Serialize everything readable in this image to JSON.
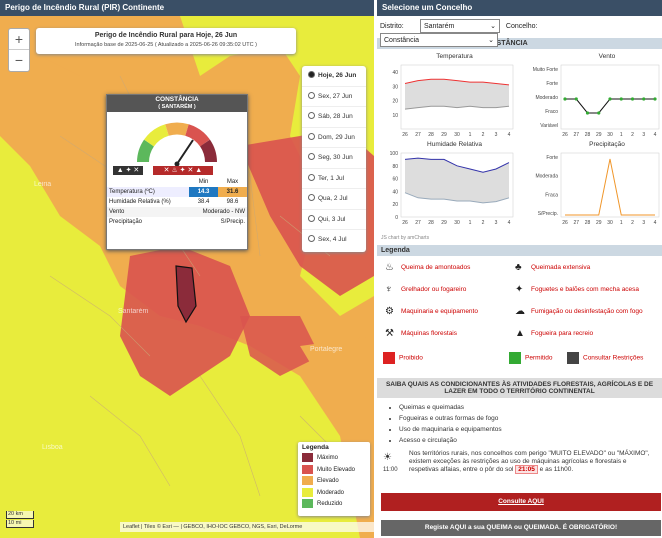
{
  "map": {
    "header": "Perigo de Incêndio Rural (PIR) Continente",
    "title": "Perigo de Incêndio Rural para Hoje, 26 Jun",
    "subtitle": "Informação base de 2025-06-25 ( Atualizado a 2025-06-26 09:35:02 UTC )",
    "zoom_in": "+",
    "zoom_out": "−",
    "days": [
      "Hoje, 26 Jun",
      "Sex, 27 Jun",
      "Sáb, 28 Jun",
      "Dom, 29 Jun",
      "Seg, 30 Jun",
      "Ter, 1 Jul",
      "Qua, 2 Jul",
      "Qui, 3 Jul",
      "Sex, 4 Jul"
    ],
    "places": [
      "Leiria",
      "Santarém",
      "Portalegre",
      "Lisboa"
    ],
    "popup": {
      "title": "CONSTÂNCIA",
      "sub": "( SANTARÉM )",
      "min_label": "Min",
      "max_label": "Max",
      "rows": [
        {
          "label": "Temperatura (ºC)",
          "min": "14.3",
          "max": "31.6"
        },
        {
          "label": "Humidade Relativa (%)",
          "min": "38.4",
          "max": "98.6"
        }
      ],
      "wind_label": "Vento",
      "wind": "Moderado - NW",
      "precip_label": "Precipitação",
      "precip": "S/Precip."
    },
    "legend": {
      "title": "Legenda",
      "items": [
        {
          "label": "Máximo",
          "color": "#8b2b3a"
        },
        {
          "label": "Muito Elevado",
          "color": "#d9534f"
        },
        {
          "label": "Elevado",
          "color": "#f0ad4e"
        },
        {
          "label": "Moderado",
          "color": "#e8ec3c"
        },
        {
          "label": "Reduzido",
          "color": "#5cb85c"
        }
      ]
    },
    "scale": [
      "20 km",
      "10 mi"
    ],
    "attribution": "Leaflet | Tiles © Esri — | GEBCO, IHO-IOC GEBCO, NGS, Esri, DeLorme"
  },
  "panel": {
    "header": "Selecione um Concelho",
    "distrito_label": "Distrito:",
    "distrito": "Santarém",
    "concelho_label": "Concelho:",
    "concelho": "Constância",
    "forecast_title": "Previsão meteorológica para: CONSTÂNCIA",
    "charts": {
      "temp": "Temperatura",
      "wind": "Vento",
      "hum": "Humidade Relativa",
      "precip": "Precipitação",
      "credit": "JS chart by amCharts"
    },
    "x_days": [
      "26",
      "27",
      "28",
      "29",
      "30",
      "1",
      "2",
      "3",
      "4"
    ],
    "wind_levels": [
      "Muito Forte",
      "Forte",
      "Moderado",
      "Fraco",
      "Variável"
    ],
    "precip_levels": [
      "Forte",
      "Moderada",
      "Fraca",
      "S/Precip."
    ],
    "temp_ticks": [
      "40",
      "30",
      "20",
      "10"
    ],
    "hum_ticks": [
      "100",
      "80",
      "60",
      "40",
      "20",
      "0"
    ],
    "legend_title": "Legenda",
    "legend_items": [
      "Queima de amontoados",
      "Queimada extensiva",
      "Grelhador ou fogareiro",
      "Foguetes e balões com mecha acesa",
      "Maquinaria e equipamento",
      "Fumigação ou desinfestação com fogo",
      "Máquinas florestais",
      "Fogueira para recreio"
    ],
    "status": [
      "Proibido",
      "Permitido",
      "Consultar Restrições"
    ],
    "info_title": "SAIBA QUAIS AS CONDICIONANTES ÀS ATIVIDADES FLORESTAIS, AGRÍCOLAS E DE LAZER EM TODO O TERRITÓRIO CONTINENTAL",
    "list": [
      "Queimas e queimadas",
      "Fogueiras e outras formas de fogo",
      "Uso de maquinaria e equipamentos",
      "Acesso e circulação"
    ],
    "note_a": "Nos territórios rurais, nos concelhos com perigo \"MUITO ELEVADO\" ou \"MÁXIMO\", existem exceções às restrições ao uso de máquinas agrícolas e florestais e respetivas alfaias, entre o pôr do sol",
    "note_time": "21:05",
    "note_b": "e as 11h00.",
    "sun_time": "11:00",
    "btn1": "Consulte AQUI",
    "btn2": "Registe AQUI a sua QUEIMA ou QUEIMADA. É OBRIGATÓRIO!"
  },
  "chart_data": [
    {
      "type": "line",
      "title": "Temperatura",
      "categories": [
        "26",
        "27",
        "28",
        "29",
        "30",
        "1",
        "2",
        "3",
        "4"
      ],
      "series": [
        {
          "values": [
            32,
            34,
            35,
            35,
            34,
            33,
            33,
            32,
            31
          ]
        },
        {
          "values": [
            14,
            15,
            16,
            16,
            15,
            16,
            15,
            15,
            16
          ]
        }
      ]
    },
    {
      "type": "line",
      "title": "Vento",
      "categories": [
        "26",
        "27",
        "28",
        "29",
        "30",
        "1",
        "2",
        "3",
        "4"
      ],
      "series": [
        {
          "values": [
            "Moderado",
            "Moderado",
            "Fraco",
            "Fraco",
            "Moderado",
            "Moderado",
            "Moderado",
            "Moderado",
            "Moderado"
          ]
        }
      ]
    },
    {
      "type": "line",
      "title": "Humidade Relativa",
      "categories": [
        "26",
        "27",
        "28",
        "29",
        "30",
        "1",
        "2",
        "3",
        "4"
      ],
      "series": [
        {
          "values": [
            90,
            92,
            90,
            90,
            80,
            75,
            70,
            75,
            85
          ]
        },
        {
          "values": [
            38,
            30,
            28,
            28,
            25,
            25,
            22,
            24,
            30
          ]
        }
      ]
    },
    {
      "type": "line",
      "title": "Precipitação",
      "categories": [
        "26",
        "27",
        "28",
        "29",
        "30",
        "1",
        "2",
        "3",
        "4"
      ],
      "series": [
        {
          "values": [
            "S/Precip.",
            "S/Precip.",
            "S/Precip.",
            "S/Precip.",
            "Forte",
            "S/Precip.",
            "S/Precip.",
            "S/Precip.",
            "S/Precip."
          ]
        }
      ]
    }
  ]
}
